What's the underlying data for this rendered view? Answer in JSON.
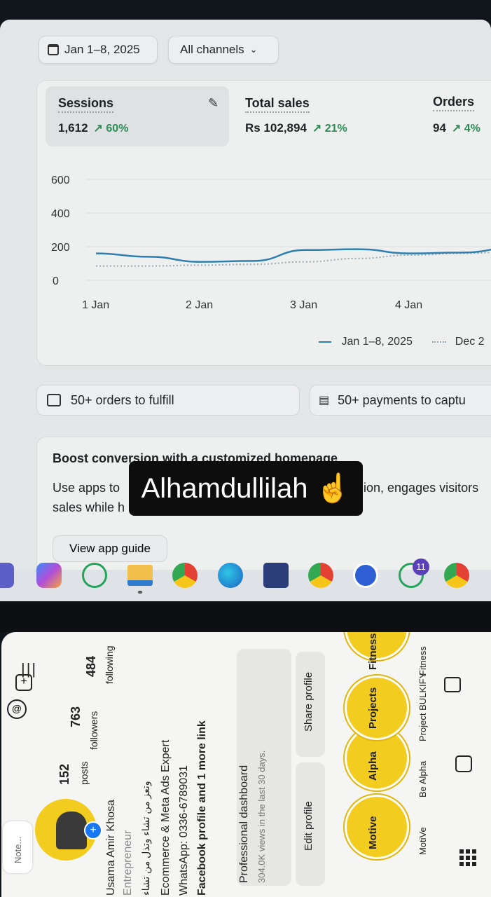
{
  "filters": {
    "date_range": "Jan 1–8, 2025",
    "channels": "All channels"
  },
  "metrics": [
    {
      "label": "Sessions",
      "value": "1,612",
      "change": "↗ 60%"
    },
    {
      "label": "Total sales",
      "value": "Rs 102,894",
      "change": "↗ 21%"
    },
    {
      "label": "Orders",
      "value": "94",
      "change": "↗ 4%"
    }
  ],
  "chart_data": {
    "type": "line",
    "title": "",
    "ylim": [
      0,
      600
    ],
    "yticks": [
      "600",
      "400",
      "200",
      "0"
    ],
    "categories": [
      "1 Jan",
      "2 Jan",
      "3 Jan",
      "4 Jan"
    ],
    "series": [
      {
        "name": "Jan 1–8, 2025",
        "x": [
          0,
          0.5,
          1,
          1.5,
          2,
          2.5,
          3,
          3.5,
          4
        ],
        "values": [
          160,
          140,
          110,
          115,
          180,
          185,
          160,
          165,
          195
        ],
        "color": "#2e7fb0",
        "style": "solid"
      },
      {
        "name": "Dec 2",
        "x": [
          0,
          0.5,
          1,
          1.5,
          2,
          2.5,
          3,
          3.5,
          4
        ],
        "values": [
          85,
          85,
          90,
          95,
          110,
          130,
          150,
          160,
          170
        ],
        "color": "#9aa7b0",
        "style": "dotted"
      }
    ],
    "legend_position": "bottom-right",
    "grid": true
  },
  "tasks": {
    "fulfill": "50+ orders to fulfill",
    "payments": "50+ payments to captu"
  },
  "boost": {
    "title": "Boost conversion with a customized homepage",
    "body_line1": "Use apps to",
    "body_line1b": "ion, engages visitors",
    "body_line2": "sales while h",
    "link": "View app guide"
  },
  "overlay_text": "Alhamdullilah ☝️",
  "taskbar": {
    "whatsapp_badge": "11"
  },
  "profile": {
    "posts_count": "152",
    "posts_label": "posts",
    "followers_count": "763",
    "followers_label": "followers",
    "following_count": "484",
    "following_label": "following",
    "name": "Usama Amir Khosa",
    "category": "Entrepreneur",
    "bio_urdu": "وتعز من تشاء وتذل من تشاء",
    "bio_line": "Ecommerce & Meta Ads Expert",
    "whatsapp": "WhatsApp: 0336-6789031",
    "links": "Facebook profile and 1 more link",
    "dashboard_title": "Professional dashboard",
    "dashboard_sub": "304.0K views in the last 30 days.",
    "edit_btn": "Edit profile",
    "share_btn": "Share profile",
    "note": "Note...",
    "highlights": [
      {
        "title": "Motive",
        "label": "MotiVe"
      },
      {
        "title": "Alpha",
        "label": "Be Alpha"
      },
      {
        "title": "Projects",
        "label": "Project BULKIFY"
      },
      {
        "title": "Fitness",
        "label": "Fitness"
      }
    ],
    "menu_icon": "|||"
  }
}
